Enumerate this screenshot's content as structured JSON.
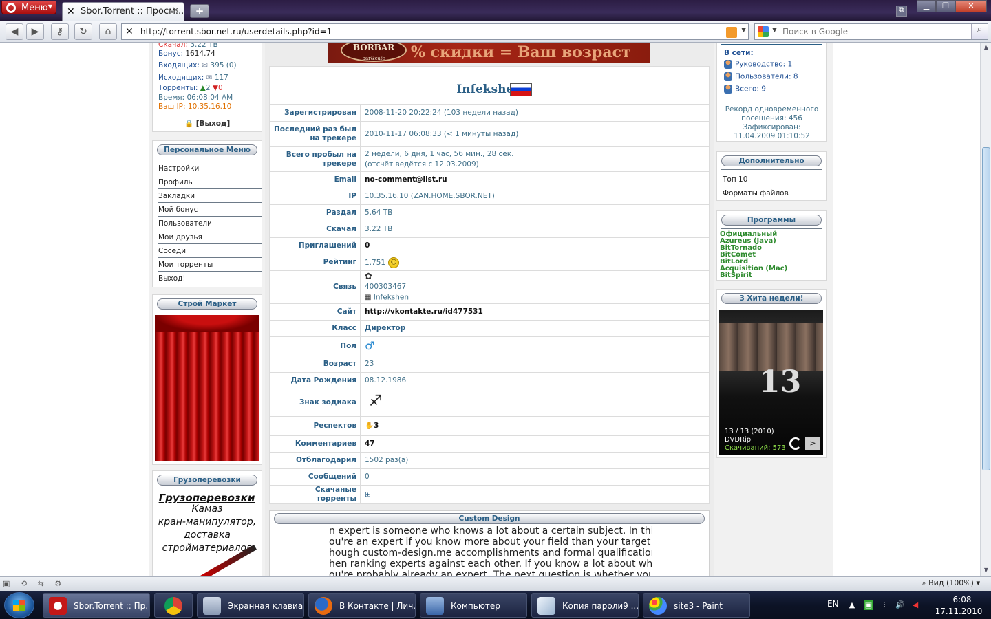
{
  "browser": {
    "menu_label": "Меню",
    "tab_title": "Sbor.Torrent :: Просм...",
    "url": "http://torrent.sbor.net.ru/userdetails.php?id=1",
    "search_placeholder": "Поиск в Google"
  },
  "left": {
    "downloaded_label": "Скачал:",
    "downloaded_value": "3.22 TB",
    "bonus_label": "Бонус:",
    "bonus_value": "1614.74",
    "inbox_label": "Входящих:",
    "inbox_value": "395 (0)",
    "outbox_label": "Исходящих:",
    "outbox_value": "117",
    "torrents_label": "Торренты:",
    "torrents_seed": "2",
    "torrents_leech": "0",
    "time_label": "Время:",
    "time_value": "06:08:04 AM",
    "ip_label": "Ваш IP:",
    "ip_value": "10.35.16.10",
    "logout": "[Выход]",
    "personal_menu_title": "Персональное Меню",
    "menu_items": [
      "Настройки",
      "Профиль",
      "Закладки",
      "Мой бонус",
      "Пользователи",
      "Мои друзья",
      "Соседи",
      "Мои торренты",
      "Выход!"
    ],
    "market_title": "Строй Маркет",
    "cargo_title": "Грузоперевозки",
    "cargo_ad_title": "Грузоперевозки",
    "cargo_ad_lines": [
      "Камаз",
      "кран-манипулятор,",
      "доставка",
      "стройматериалов"
    ]
  },
  "center": {
    "banner_logo": "BORBAR",
    "banner_logo_sub": "bar&cafe",
    "banner_text": "% скидки = Ваш возраст",
    "username": "Infekshen",
    "rows": [
      {
        "k": "Зарегистрирован",
        "v": "2008-11-20 20:22:24 (103 недели назад)"
      },
      {
        "k": "Последний раз был на трекере",
        "v": "2010-11-17 06:08:33 (< 1 минуты назад)"
      },
      {
        "k": "Всего пробыл на трекере",
        "v": "2 недели, 6 дня, 1 час, 56 мин., 28 сек.",
        "v2": "(отсчёт ведётся с 12.03.2009)"
      },
      {
        "k": "Email",
        "v": "no-comment@list.ru"
      },
      {
        "k": "IP",
        "v": "10.35.16.10 (ZAN.HOME.SBOR.NET)"
      },
      {
        "k": "Раздал",
        "v": "5.64 TB"
      },
      {
        "k": "Скачал",
        "v": "3.22 TB"
      },
      {
        "k": "Приглашений",
        "v": "0"
      },
      {
        "k": "Рейтинг",
        "v": "1.751"
      },
      {
        "k": "Связь",
        "v": "400303467",
        "v2": "Infekshen"
      },
      {
        "k": "Сайт",
        "v": "http://vkontakte.ru/id477531"
      },
      {
        "k": "Класс",
        "v": "Директор"
      },
      {
        "k": "Пол",
        "v": "♂"
      },
      {
        "k": "Возраст",
        "v": "23"
      },
      {
        "k": "Дата Рождения",
        "v": "08.12.1986"
      },
      {
        "k": "Знак зодиака",
        "v": "♐"
      },
      {
        "k": "Респектов",
        "v": "3"
      },
      {
        "k": "Комментариев",
        "v": "47"
      },
      {
        "k": "Отблагодарил",
        "v": "1502 раз(а)"
      },
      {
        "k": "Сообщений",
        "v": "0"
      },
      {
        "k": "Скачаные торренты",
        "v": "⊞"
      }
    ],
    "custom_design_title": "Custom Design",
    "custom_lines": [
      "n expert is someone who knows a lot about a certain subject.  In this c",
      "ou're an expert if you know more about your field than your target mar",
      "hough custom-design.me  accomplishments and formal qualification",
      "hen ranking experts against each other. If you know a lot about what y",
      "ou're probably already an expert. The next question is whether your tar"
    ]
  },
  "right": {
    "online_label": "В сети:",
    "leaders": "Руководство: 1",
    "users": "Пользователи: 8",
    "total": "Всего: 9",
    "record_lines": [
      "Рекорд одновременного",
      "посещения: 456",
      "Зафиксирован:",
      "11.04.2009 01:10:52"
    ],
    "extra_title": "Дополнительно",
    "extra_items": [
      "Топ 10",
      "Форматы файлов"
    ],
    "programs_title": "Программы",
    "programs": [
      "Официальный",
      "Azureus (Java)",
      "BitTornado",
      "BitComet",
      "BitLord",
      "Acquisition (Mac)",
      "BitSpirit"
    ],
    "hits_title": "3 Хита недели!",
    "movie_line1": "13 / 13 (2010)",
    "movie_line2": "DVDRip",
    "movie_line3": "Скачиваний: 573"
  },
  "status": {
    "zoom": "Вид (100%)"
  },
  "taskbar": {
    "items": [
      "Sbor.Torrent :: Пр...",
      "",
      "Экранная клавиа...",
      "В Контакте | Лич...",
      "Компьютер",
      "Копия пароли9 ...",
      "site3 - Paint"
    ],
    "lang": "EN",
    "time": "6:08",
    "date": "17.11.2010"
  },
  "colors": {
    "accent": "#2b5f86",
    "opera_red": "#c41818"
  }
}
